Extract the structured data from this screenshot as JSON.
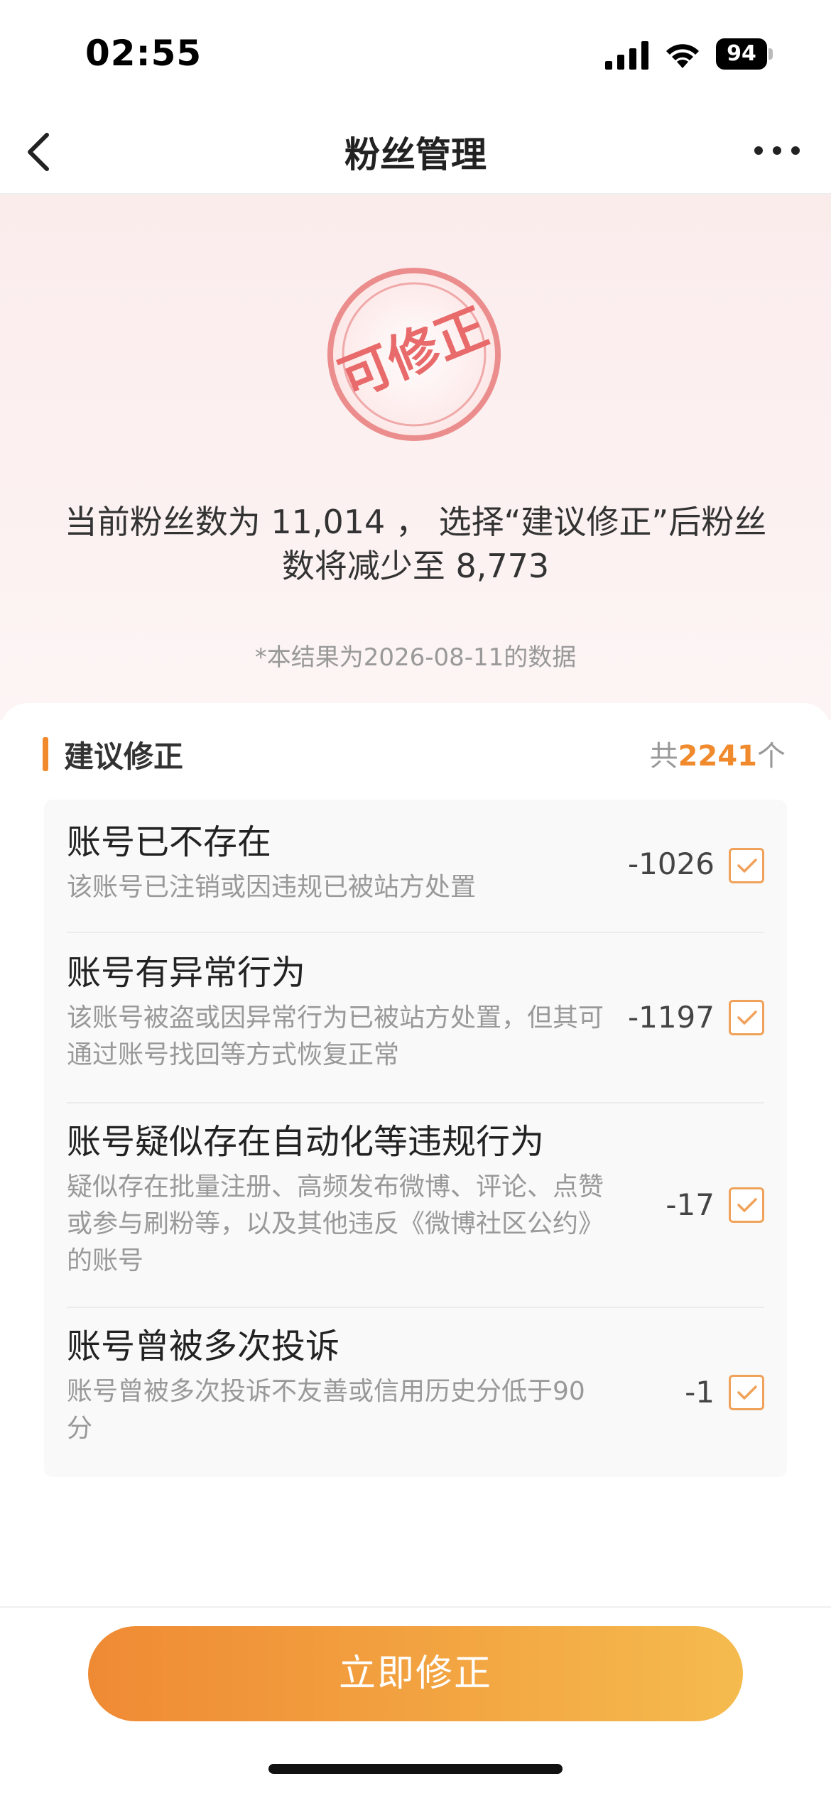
{
  "status_bar": {
    "time": "02:55",
    "battery": "94"
  },
  "nav": {
    "title": "粉丝管理"
  },
  "hero": {
    "stamp_text": "可修正",
    "summary_line1": "当前粉丝数为 11,014 ， 选择“建议修正”后粉丝",
    "summary_line2": "数将减少至 8,773",
    "note": "*本结果为2026-08-11的数据"
  },
  "section": {
    "title": "建议修正",
    "count_prefix": "共",
    "count": "2241",
    "count_suffix": "个"
  },
  "items": [
    {
      "title": "账号已不存在",
      "desc": "该账号已注销或因违规已被站方处置",
      "count": "-1026",
      "checked": true
    },
    {
      "title": "账号有异常行为",
      "desc": "该账号被盗或因异常行为已被站方处置，但其可通过账号找回等方式恢复正常",
      "count": "-1197",
      "checked": true
    },
    {
      "title": "账号疑似存在自动化等违规行为",
      "desc": "疑似存在批量注册、高频发布微博、评论、点赞或参与刷粉等，以及其他违反《微博社区公约》的账号",
      "count": "-17",
      "checked": true
    },
    {
      "title": "账号曾被多次投诉",
      "desc": "账号曾被多次投诉不友善或信用历史分低于90分",
      "count": "-1",
      "checked": true
    }
  ],
  "footer": {
    "button_label": "立即修正"
  },
  "colors": {
    "accent": "#f08a2c",
    "stamp": "#e86a6a",
    "hero_bg": "#fbecec"
  }
}
